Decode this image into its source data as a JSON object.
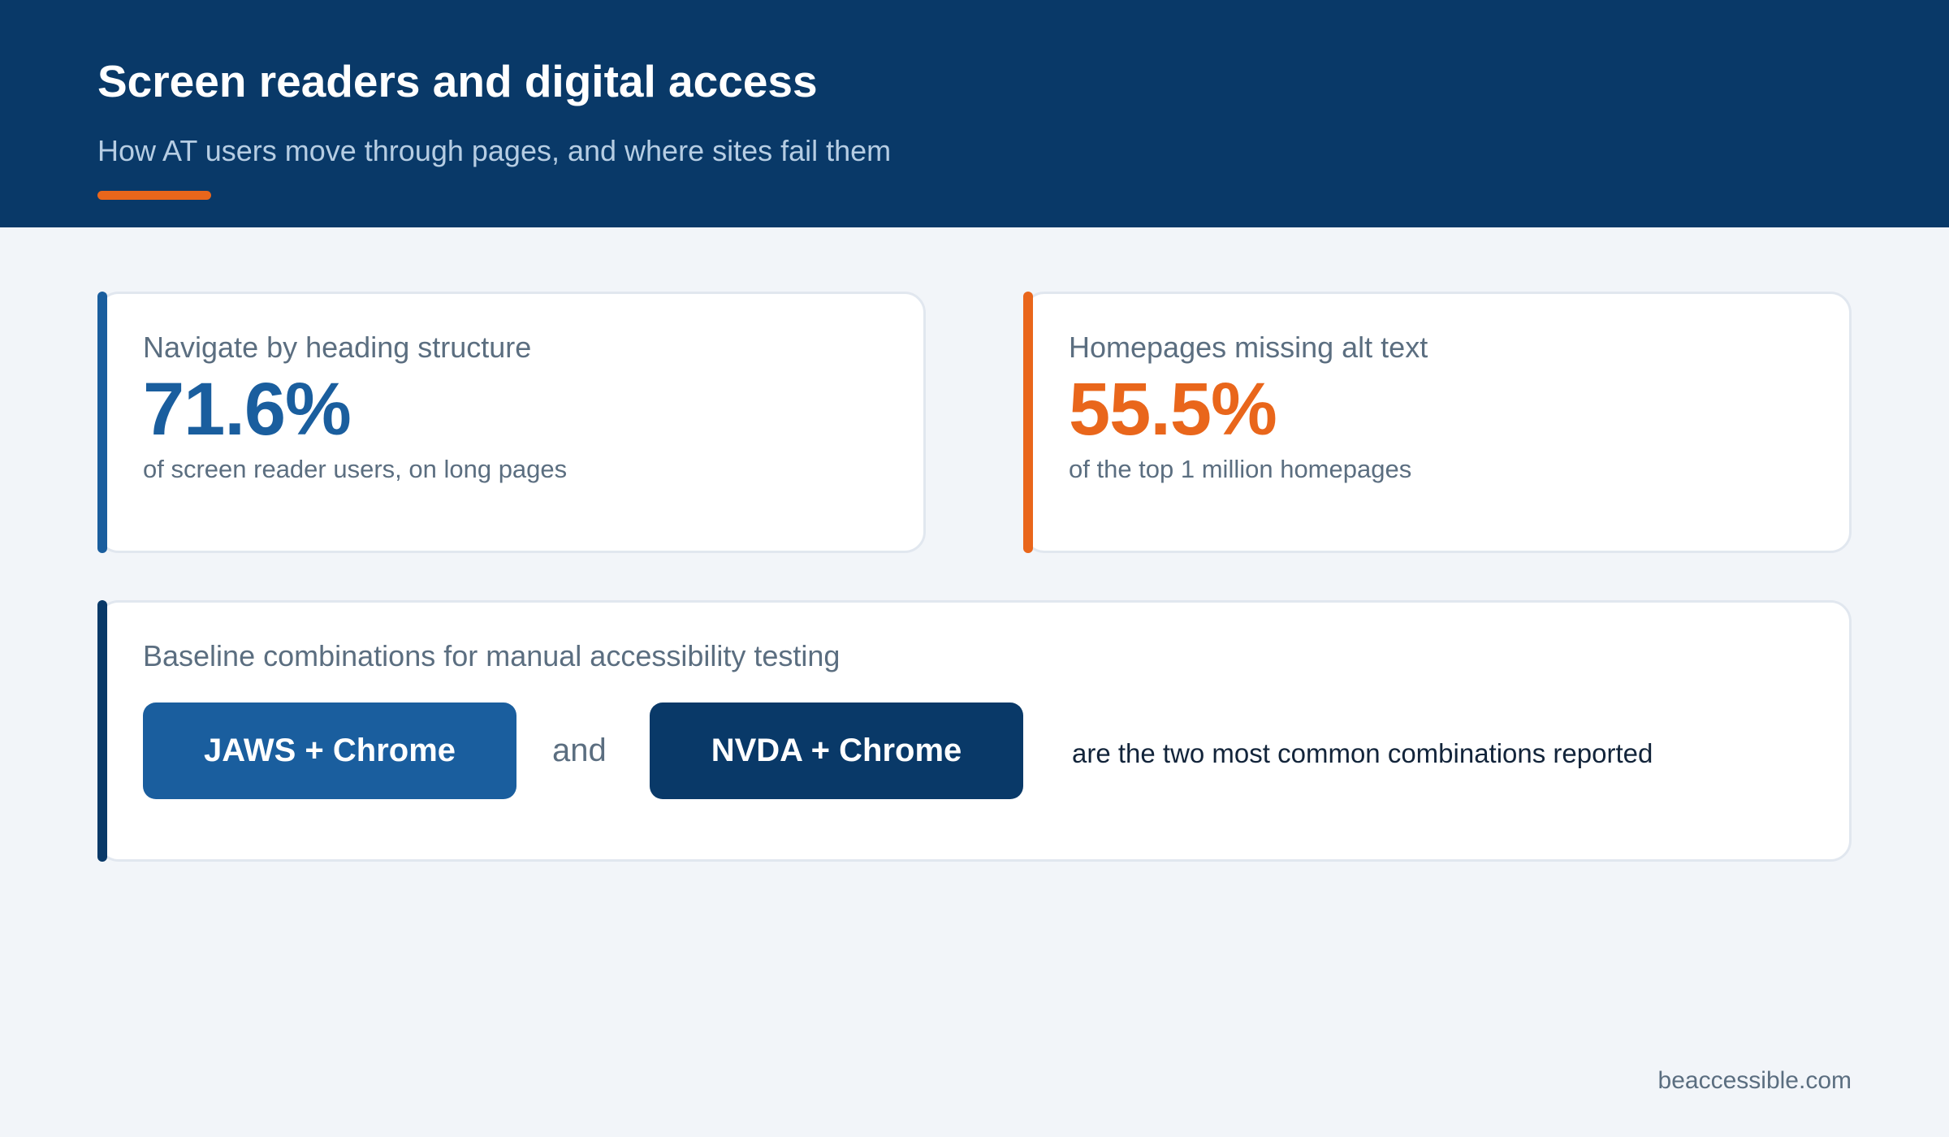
{
  "header": {
    "title": "Screen readers and digital access",
    "subtitle": "How AT users move through pages, and where sites fail them"
  },
  "stats": [
    {
      "label": "Navigate by heading structure",
      "value": "71.6%",
      "description": "of screen reader users, on long pages",
      "accent_color": "#1a5e9e"
    },
    {
      "label": "Homepages missing alt text",
      "value": "55.5%",
      "description": "of the top 1 million homepages",
      "accent_color": "#e9661b"
    }
  ],
  "combos": {
    "label": "Baseline combinations for manual accessibility testing",
    "first": "JAWS + Chrome",
    "connector": "and",
    "second": "NVDA + Chrome",
    "tagline": "are the two most common combinations reported"
  },
  "footer": {
    "source": "beaccessible.com"
  },
  "colors": {
    "header_bg": "#093968",
    "accent_orange": "#e9661b",
    "primary_blue": "#1a5e9e",
    "navy": "#093968",
    "page_bg": "#f2f5f9"
  }
}
